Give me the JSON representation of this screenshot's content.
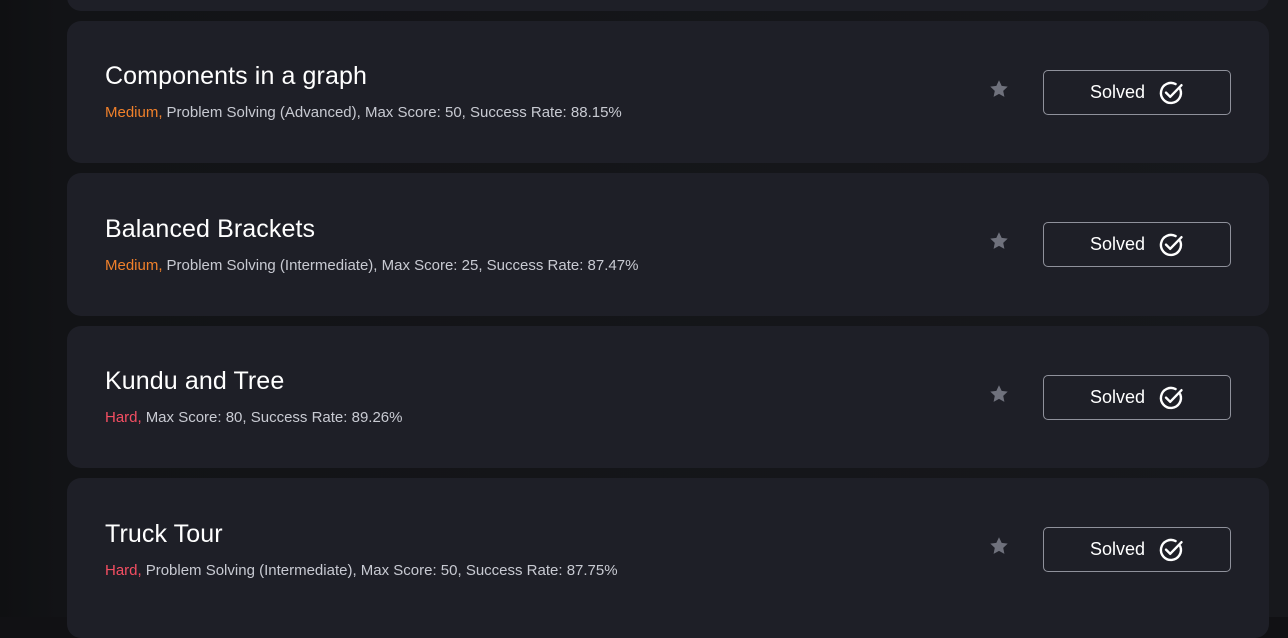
{
  "colors": {
    "card_bg": "#1e1f27",
    "medium": "#f0802b",
    "hard": "#f44e62",
    "meta_text": "#c8cad2",
    "star": "#6f717c"
  },
  "problems": [
    {
      "title": "Components in a graph",
      "difficulty": "Medium,",
      "details": "Problem Solving (Advanced), Max Score: 50, Success Rate: 88.15%",
      "status": "Solved",
      "icon": "star-icon"
    },
    {
      "title": "Balanced Brackets",
      "difficulty": "Medium,",
      "details": "Problem Solving (Intermediate), Max Score: 25, Success Rate: 87.47%",
      "status": "Solved",
      "icon": "star-icon"
    },
    {
      "title": "Kundu and Tree",
      "difficulty": "Hard,",
      "details": "Max Score: 80, Success Rate: 89.26%",
      "status": "Solved",
      "icon": "star-icon"
    },
    {
      "title": "Truck Tour",
      "difficulty": "Hard,",
      "details": "Problem Solving (Intermediate), Max Score: 50, Success Rate: 87.75%",
      "status": "Solved",
      "icon": "star-icon"
    }
  ]
}
